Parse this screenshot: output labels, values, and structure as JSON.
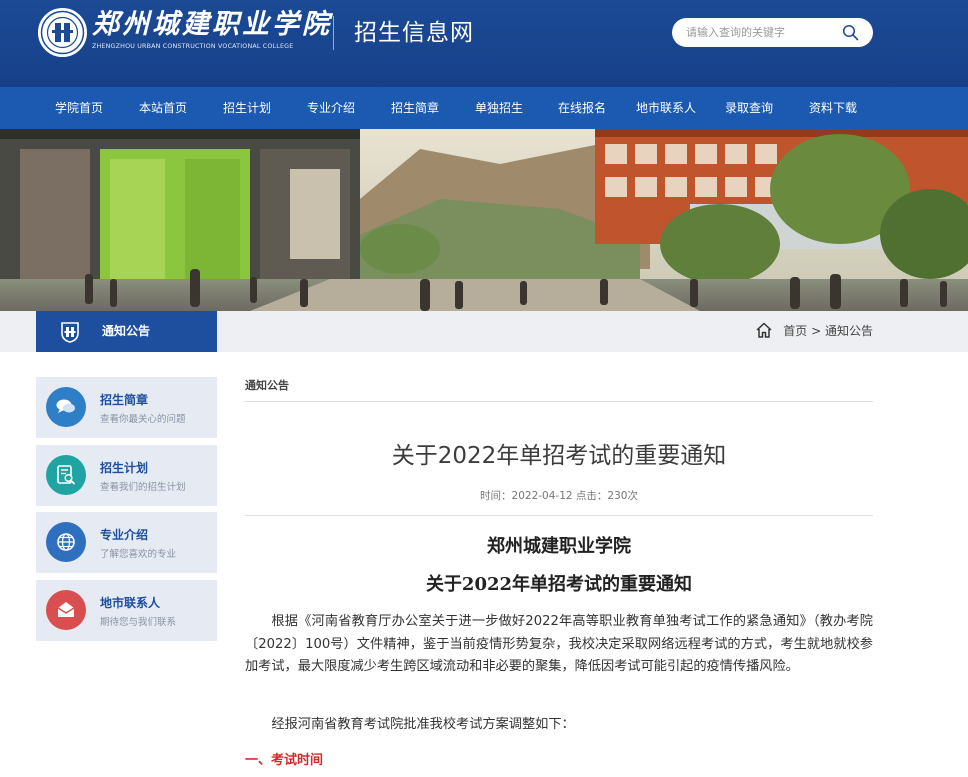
{
  "header": {
    "logo_cn": "郑州城建职业学院",
    "logo_en": "ZHENGZHOU URBAN CONSTRUCTION VOCATIONAL COLLEGE",
    "site_name": "招生信息网",
    "search_placeholder": "请输入查询的关键字",
    "colors": {
      "header_bg": "#1c4a95",
      "nav_bg": "#1b5ab0"
    }
  },
  "nav": {
    "items": [
      {
        "label": "学院首页"
      },
      {
        "label": "本站首页"
      },
      {
        "label": "招生计划"
      },
      {
        "label": "专业介绍"
      },
      {
        "label": "招生简章"
      },
      {
        "label": "单独招生"
      },
      {
        "label": "在线报名"
      },
      {
        "label": "地市联系人"
      },
      {
        "label": "录取查询"
      },
      {
        "label": "资料下载"
      }
    ]
  },
  "location": {
    "section_title": "通知公告",
    "breadcrumb": {
      "home": "首页",
      "separator": ">",
      "current": "通知公告"
    }
  },
  "sidebar": {
    "items": [
      {
        "title": "招生简章",
        "desc": "查看你最关心的问题",
        "icon": "chat-bubbles-icon",
        "color": "#2f7fc7"
      },
      {
        "title": "招生计划",
        "desc": "查看我们的招生计划",
        "icon": "document-search-icon",
        "color": "#1fa3a3"
      },
      {
        "title": "专业介绍",
        "desc": "了解您喜欢的专业",
        "icon": "globe-icon",
        "color": "#2f6fc0"
      },
      {
        "title": "地市联系人",
        "desc": "期待您与我们联系",
        "icon": "envelope-icon",
        "color": "#d94f4f"
      }
    ]
  },
  "content": {
    "section_header": "通知公告",
    "title": "关于2022年单招考试的重要通知",
    "meta": "时间：2022-04-12 点击：230次",
    "doc_school": "郑州城建职业学院",
    "doc_title": "关于2022年单招考试的重要通知",
    "paragraph1": "根据《河南省教育厅办公室关于进一步做好2022年高等职业教育单独考试工作的紧急通知》（教办考院〔2022〕100号）文件精神，鉴于当前疫情形势复杂，我校决定采取网络远程考试的方式，考生就地就校参加考试，最大限度减少考生跨区域流动和非必要的聚集，降低因考试可能引起的疫情传播风险。",
    "paragraph2": "经报河南省教育考试院批准我校考试方案调整如下：",
    "heading1": "一、考试时间",
    "heading_color": "#d42a2a"
  }
}
